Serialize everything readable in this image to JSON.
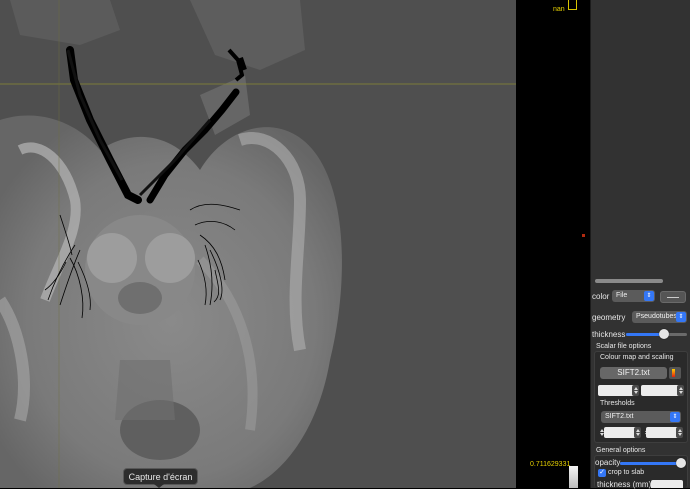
{
  "viewer": {
    "nan_label": "nan",
    "scale_max_label": "0.711629331",
    "tooltip": "Capture d'écran"
  },
  "panel": {
    "color_label": "color",
    "color_value": "File",
    "geometry_label": "geometry",
    "geometry_value": "Pseudotubes",
    "thickness_label": "thickness",
    "thickness_level": 0.62,
    "scalar_file_options": "Scalar file options",
    "colour_map_title": "Colour map and scaling",
    "colour_map_file": "SIFT2.txt",
    "thresholds_title": "Thresholds",
    "thresholds_file": "SIFT2.txt",
    "general_options": "General options",
    "opacity_label": "opacity",
    "opacity_level": 0.95,
    "crop_label": "crop to slab",
    "crop_checked": true,
    "thickness_mm_label": "thickness (mm)"
  },
  "colors": {
    "accent": "#3477f6",
    "panel_bg": "#323232",
    "viewer_bg": "#4f4f4f",
    "label_yellow": "#e6d000"
  }
}
